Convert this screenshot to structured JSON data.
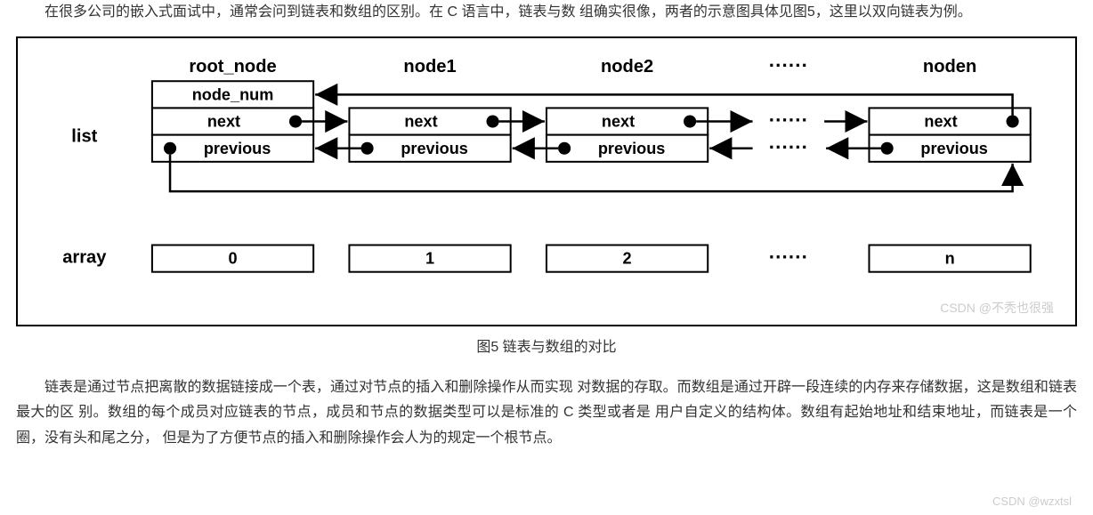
{
  "paragraphs": {
    "intro": "在很多公司的嵌入式面试中，通常会问到链表和数组的区别。在 C 语言中，链表与数 组确实很像，两者的示意图具体见图5，这里以双向链表为例。",
    "detail": "链表是通过节点把离散的数据链接成一个表，通过对节点的插入和删除操作从而实现 对数据的存取。而数组是通过开辟一段连续的内存来存储数据，这是数组和链表最大的区 别。数组的每个成员对应链表的节点，成员和节点的数据类型可以是标准的 C 类型或者是 用户自定义的结构体。数组有起始地址和结束地址，而链表是一个圈，没有头和尾之分， 但是为了方便节点的插入和删除操作会人为的规定一个根节点。"
  },
  "figure": {
    "caption": "图5 链表与数组的对比",
    "labels": {
      "list": "list",
      "array": "array",
      "root_node": "root_node",
      "node1": "node1",
      "node2": "node2",
      "noden": "noden",
      "node_num": "node_num",
      "next": "next",
      "previous": "previous",
      "ellipsis": "······"
    },
    "array_items": [
      "0",
      "1",
      "2",
      "n"
    ],
    "watermark": "CSDN @不秃也很强",
    "watermark2": "CSDN @wzxtsl"
  },
  "chart_data": {
    "type": "table",
    "title": "链表与数组的对比",
    "list": {
      "label": "list",
      "nodes": [
        {
          "name": "root_node",
          "fields": [
            "node_num",
            "next",
            "previous"
          ]
        },
        {
          "name": "node1",
          "fields": [
            "next",
            "previous"
          ]
        },
        {
          "name": "node2",
          "fields": [
            "next",
            "previous"
          ]
        },
        {
          "name": "...",
          "fields": []
        },
        {
          "name": "noden",
          "fields": [
            "next",
            "previous"
          ]
        }
      ],
      "next_links": [
        [
          "root_node",
          "node1"
        ],
        [
          "node1",
          "node2"
        ],
        [
          "node2",
          "..."
        ],
        [
          "...",
          "noden"
        ],
        [
          "noden",
          "root_node"
        ]
      ],
      "previous_links": [
        [
          "root_node",
          "noden"
        ],
        [
          "noden",
          "..."
        ],
        [
          "...",
          "node2"
        ],
        [
          "node2",
          "node1"
        ],
        [
          "node1",
          "root_node"
        ]
      ]
    },
    "array": {
      "label": "array",
      "cells": [
        "0",
        "1",
        "2",
        "...",
        "n"
      ]
    }
  }
}
